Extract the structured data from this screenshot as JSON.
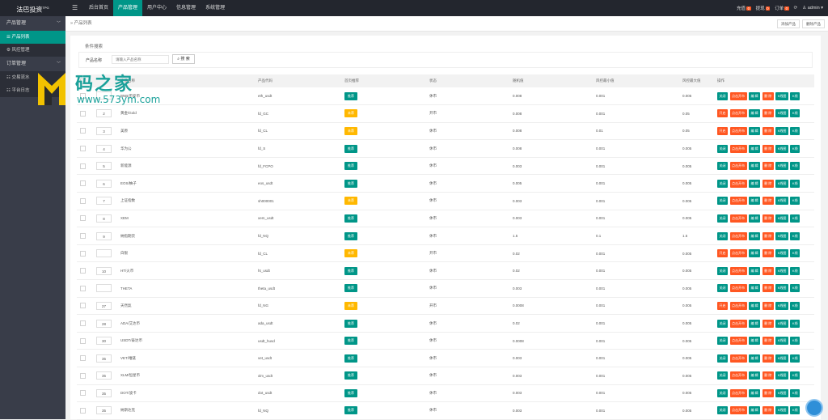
{
  "app": {
    "title": "法巴投资",
    "title_sup": "TPG"
  },
  "topnav": [
    "后台首页",
    "产品管理",
    "用户中心",
    "信息管理",
    "系统管理"
  ],
  "topright": {
    "items": [
      {
        "label": "充值",
        "count": "0"
      },
      {
        "label": "提现",
        "count": "0"
      },
      {
        "label": "订单",
        "count": "0"
      }
    ],
    "user": "admin"
  },
  "sidebar": {
    "group1": "产品管理",
    "items1": [
      "产品列表",
      "风控管理"
    ],
    "group2": "订单管理",
    "items2": [
      "交易流水",
      "平台日志"
    ]
  },
  "breadcrumb": "产品列表",
  "header_buttons": [
    "添加产品",
    "删除产品"
  ],
  "filter": {
    "title": "条件搜索",
    "label": "产品名称",
    "placeholder": "请输入产品名称",
    "button": "搜 索"
  },
  "columns": [
    "",
    "",
    "产品名称",
    "产品代码",
    "首页推荐",
    "状态",
    "随机值",
    "风控最小值",
    "风控最大值",
    "操作"
  ],
  "ops": {
    "close": "关闭",
    "open": "开启",
    "stop": "点击开市",
    "edit": "编 辑",
    "del": "删 除",
    "k1": "K线图",
    "k2": "K线"
  },
  "rows": [
    {
      "id": "",
      "name": "BNB/币安币",
      "code": "eth_usdt",
      "rec": "推荐",
      "rec_c": "green",
      "status": "休市",
      "rand": "0.008",
      "min": "0.001",
      "max": "0.005",
      "on": true
    },
    {
      "id": "2",
      "name": "黄金/Gold",
      "code": "fd_GC",
      "rec": "未荐",
      "rec_c": "yellow",
      "status": "开市",
      "rand": "0.008",
      "min": "0.001",
      "max": "0.05",
      "on": false
    },
    {
      "id": "3",
      "name": "美原",
      "code": "fd_CL",
      "rec": "未荐",
      "rec_c": "yellow",
      "status": "休市",
      "rand": "0.008",
      "min": "0.01",
      "max": "0.05",
      "on": false
    },
    {
      "id": "4",
      "name": "华为公",
      "code": "fd_S",
      "rec": "推荐",
      "rec_c": "green",
      "status": "休市",
      "rand": "0.008",
      "min": "0.001",
      "max": "0.005",
      "on": true
    },
    {
      "id": "5",
      "name": "新能源",
      "code": "fd_FCPO",
      "rec": "推荐",
      "rec_c": "green",
      "status": "休市",
      "rand": "0.003",
      "min": "0.001",
      "max": "0.005",
      "on": true
    },
    {
      "id": "6",
      "name": "EOS/柚子",
      "code": "eos_usdt",
      "rec": "推荐",
      "rec_c": "green",
      "status": "休市",
      "rand": "0.005",
      "min": "0.001",
      "max": "0.005",
      "on": true
    },
    {
      "id": "7",
      "name": "上证指数",
      "code": "sh000001",
      "rec": "未荐",
      "rec_c": "yellow",
      "status": "休市",
      "rand": "0.003",
      "min": "0.001",
      "max": "0.005",
      "on": true
    },
    {
      "id": "8",
      "name": "XEM",
      "code": "xem_usdt",
      "rec": "推荐",
      "rec_c": "green",
      "status": "休市",
      "rand": "0.003",
      "min": "0.001",
      "max": "0.005",
      "on": true
    },
    {
      "id": "9",
      "name": "纳指期货",
      "code": "fd_NQ",
      "rec": "推荐",
      "rec_c": "green",
      "status": "休市",
      "rand": "1.5",
      "min": "0.1",
      "max": "1.5",
      "on": true
    },
    {
      "id": "",
      "name": "白银",
      "code": "fd_CL",
      "rec": "未荐",
      "rec_c": "yellow",
      "status": "开市",
      "rand": "0.02",
      "min": "0.001",
      "max": "0.005",
      "on": false
    },
    {
      "id": "10",
      "name": "HT/火币",
      "code": "ht_usdt",
      "rec": "推荐",
      "rec_c": "green",
      "status": "休市",
      "rand": "0.02",
      "min": "0.001",
      "max": "0.005",
      "on": true
    },
    {
      "id": "",
      "name": "THETA",
      "code": "theta_usdt",
      "rec": "推荐",
      "rec_c": "green",
      "status": "休市",
      "rand": "0.003",
      "min": "0.001",
      "max": "0.005",
      "on": true
    },
    {
      "id": "27",
      "name": "天然氣",
      "code": "fd_NG",
      "rec": "未荐",
      "rec_c": "yellow",
      "status": "开市",
      "rand": "0.0008",
      "min": "0.001",
      "max": "0.005",
      "on": false
    },
    {
      "id": "28",
      "name": "ADA/艾达币",
      "code": "ada_usdt",
      "rec": "推荐",
      "rec_c": "green",
      "status": "休市",
      "rand": "0.02",
      "min": "0.001",
      "max": "0.005",
      "on": true
    },
    {
      "id": "30",
      "name": "USDT/泰达币",
      "code": "usdt_husd",
      "rec": "推荐",
      "rec_c": "green",
      "status": "休市",
      "rand": "0.0008",
      "min": "0.001",
      "max": "0.005",
      "on": true
    },
    {
      "id": "35",
      "name": "VET/唯链",
      "code": "vet_usdt",
      "rec": "推荐",
      "rec_c": "green",
      "status": "休市",
      "rand": "0.003",
      "min": "0.001",
      "max": "0.005",
      "on": true
    },
    {
      "id": "35",
      "name": "XLM/恒星币",
      "code": "xlm_usdt",
      "rec": "推荐",
      "rec_c": "green",
      "status": "休市",
      "rand": "0.003",
      "min": "0.001",
      "max": "0.005",
      "on": true
    },
    {
      "id": "35",
      "name": "DOT/波卡",
      "code": "dot_usdt",
      "rec": "推荐",
      "rec_c": "green",
      "status": "休市",
      "rand": "0.003",
      "min": "0.001",
      "max": "0.005",
      "on": true
    },
    {
      "id": "35",
      "name": "纳斯达克",
      "code": "fd_NQ",
      "rec": "推荐",
      "rec_c": "green",
      "status": "休市",
      "rand": "0.003",
      "min": "0.001",
      "max": "0.005",
      "on": true
    }
  ],
  "watermark": {
    "text": "码之家",
    "url": "www.573ym.com"
  },
  "colors": {
    "accent": "#009688",
    "warn": "#ff5722",
    "yellow": "#ffb800",
    "dark": "#23262e"
  }
}
